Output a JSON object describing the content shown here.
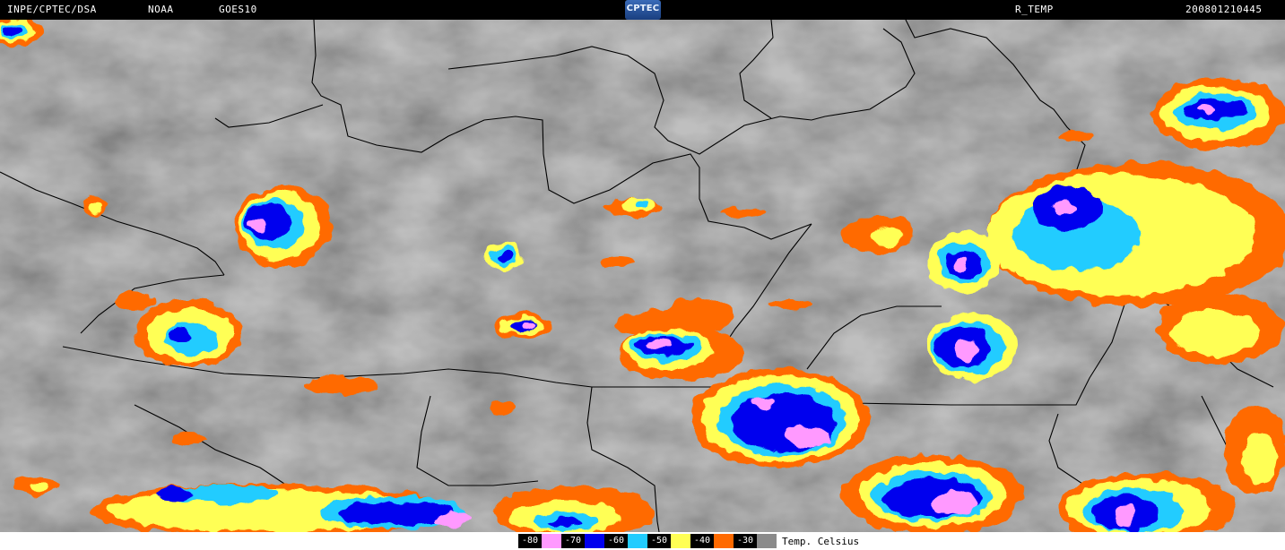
{
  "header": {
    "org": "INPE/CPTEC/DSA",
    "agency": "NOAA",
    "satellite": "GOES10",
    "logo_text": "CPTEC",
    "product": "R_TEMP",
    "timestamp": "200801210445"
  },
  "legend": {
    "title": "Temp. Celsius",
    "entries": [
      {
        "label": "-80",
        "color": "#ff99ff"
      },
      {
        "label": "-70",
        "color": "#0000ee"
      },
      {
        "label": "-60",
        "color": "#22ccff"
      },
      {
        "label": "-50",
        "color": "#ffff55"
      },
      {
        "label": "-40",
        "color": "#ff6a00"
      },
      {
        "label": "-30",
        "color": "#8a8a8a"
      }
    ]
  },
  "map": {
    "background": "#6d6d6d",
    "border_color": "#000000"
  }
}
